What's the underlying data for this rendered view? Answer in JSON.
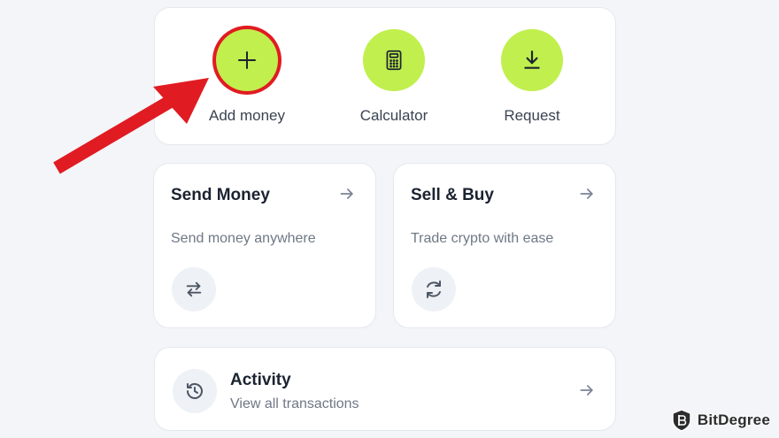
{
  "quick_actions": {
    "add": {
      "label": "Add money",
      "icon": "plus-icon"
    },
    "calculator": {
      "label": "Calculator",
      "icon": "calculator-icon"
    },
    "request": {
      "label": "Request",
      "icon": "download-icon"
    }
  },
  "send_card": {
    "title": "Send Money",
    "description": "Send money anywhere",
    "icon": "swap-arrows-icon"
  },
  "sell_card": {
    "title": "Sell & Buy",
    "description": "Trade crypto with ease",
    "icon": "refresh-icon"
  },
  "activity_card": {
    "title": "Activity",
    "description": "View all transactions",
    "icon": "history-icon"
  },
  "watermark": {
    "name": "BitDegree"
  },
  "colors": {
    "accent": "#c1ef4d",
    "highlight": "#e11b22",
    "background": "#f3f5f8",
    "card": "#ffffff"
  }
}
